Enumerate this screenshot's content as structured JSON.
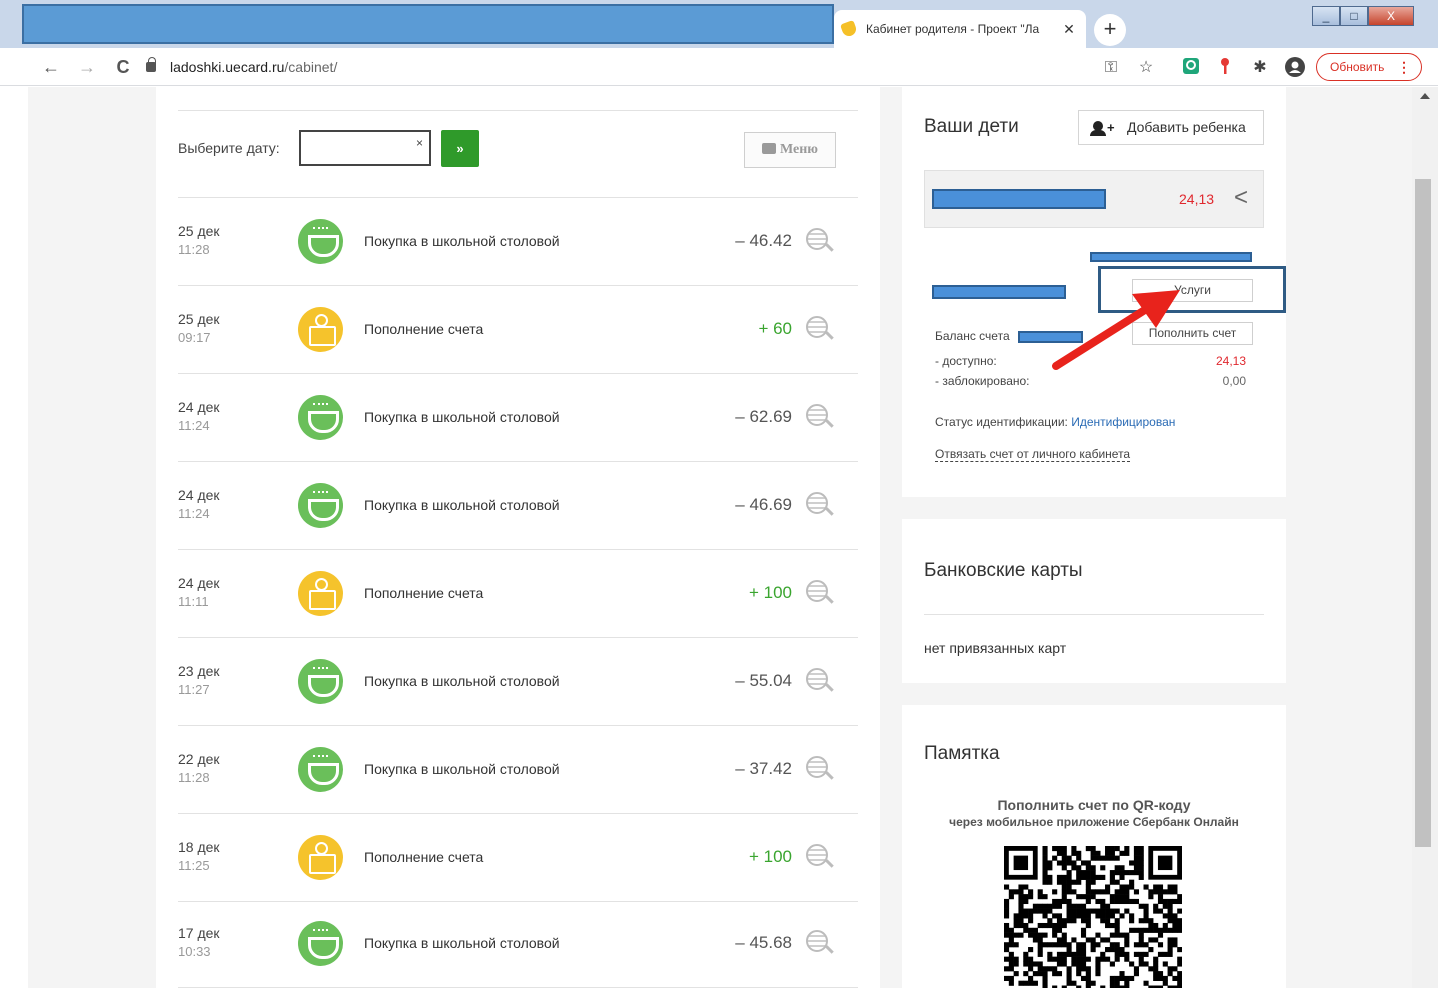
{
  "browser": {
    "tab_title": "Кабинет родителя - Проект \"Ла",
    "tab_close": "✕",
    "new_tab": "+",
    "back": "←",
    "forward": "→",
    "reload": "C",
    "url_host": "ladoshki.uecard.ru",
    "url_path": "/cabinet/",
    "update_label": "Обновить",
    "menu_dots": "⋮",
    "win_minimize": "_",
    "win_maximize": "□",
    "win_close": "X",
    "ext_key": "⚿",
    "ext_star": "☆",
    "ext_puzzle": "✱"
  },
  "filter": {
    "date_label": "Выберите дату:",
    "date_value": "",
    "clear": "×",
    "go_label": "»",
    "menu_label": "Меню"
  },
  "transactions": [
    {
      "date": "25 дек",
      "time": "11:28",
      "type": "food",
      "description": "Покупка в школьной столовой",
      "amount": "– 46.42",
      "sign": "minus"
    },
    {
      "date": "25 дек",
      "time": "09:17",
      "type": "topup",
      "description": "Пополнение счета",
      "amount": "+ 60",
      "sign": "plus"
    },
    {
      "date": "24 дек",
      "time": "11:24",
      "type": "food",
      "description": "Покупка в школьной столовой",
      "amount": "– 62.69",
      "sign": "minus"
    },
    {
      "date": "24 дек",
      "time": "11:24",
      "type": "food",
      "description": "Покупка в школьной столовой",
      "amount": "– 46.69",
      "sign": "minus"
    },
    {
      "date": "24 дек",
      "time": "11:11",
      "type": "topup",
      "description": "Пополнение счета",
      "amount": "+ 100",
      "sign": "plus"
    },
    {
      "date": "23 дек",
      "time": "11:27",
      "type": "food",
      "description": "Покупка в школьной столовой",
      "amount": "– 55.04",
      "sign": "minus"
    },
    {
      "date": "22 дек",
      "time": "11:28",
      "type": "food",
      "description": "Покупка в школьной столовой",
      "amount": "– 37.42",
      "sign": "minus"
    },
    {
      "date": "18 дек",
      "time": "11:25",
      "type": "topup",
      "description": "Пополнение счета",
      "amount": "+ 100",
      "sign": "plus"
    },
    {
      "date": "17 дек",
      "time": "10:33",
      "type": "food",
      "description": "Покупка в школьной столовой",
      "amount": "– 45.68",
      "sign": "minus"
    }
  ],
  "kids": {
    "title": "Ваши дети",
    "add_child_label": "Добавить ребенка",
    "add_plus": "+",
    "child_balance": "24,13",
    "chevron": "<",
    "services_label": "Услуги",
    "topup_label": "Пополнить счет",
    "balance_label": "Баланс счета",
    "available_label": "- доступно:",
    "available_value": "24,13",
    "blocked_label": "- заблокировано:",
    "blocked_value": "0,00",
    "status_label": "Статус идентификации:",
    "status_value": "Идентифицирован",
    "unlink_label": "Отвязать счет от личного кабинета"
  },
  "cards": {
    "title": "Банковские карты",
    "empty_text": "нет привязанных карт"
  },
  "memo": {
    "title": "Памятка",
    "qr_heading": "Пополнить счет по QR-коду",
    "qr_subheading": "через мобильное приложение Сбербанк Онлайн"
  },
  "colors": {
    "accent_green": "#2f9a2a",
    "plus_green": "#3aa52f",
    "balance_red": "#e0282e",
    "redaction_blue": "#4a90d9",
    "annotation_arrow": "#e8231c",
    "annotation_frame": "#2f5b84"
  }
}
